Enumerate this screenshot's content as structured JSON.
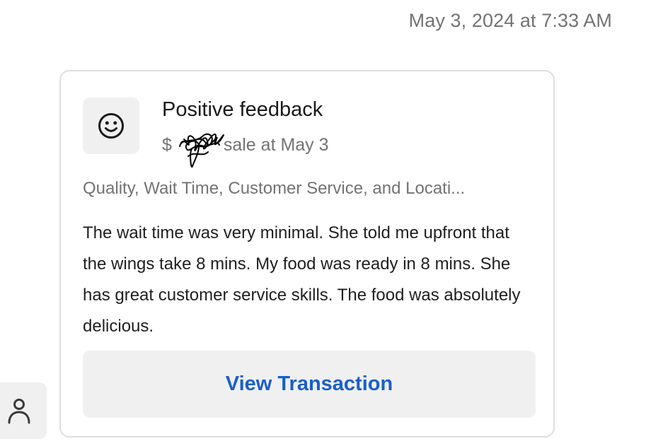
{
  "header": {
    "timestamp": "May 3, 2024 at 7:33 AM"
  },
  "feedback_card": {
    "icon": "smiley-face-icon",
    "title": "Positive feedback",
    "subtitle_prefix": "$",
    "subtitle_suffix": " sale at May 3",
    "categories": "Quality, Wait Time, Customer Service, and Locati...",
    "comment": "The wait time was very minimal. She told me upfront that the wings take 8 mins. My food was ready in 8 mins. She has great customer service skills. The food was absolutely delicious.",
    "button_label": "View Transaction"
  },
  "side_tab": {
    "icon": "person-icon"
  },
  "colors": {
    "accent": "#1a5fc8",
    "muted_text": "#737373",
    "surface": "#f0f0f0",
    "border": "#dedede"
  }
}
